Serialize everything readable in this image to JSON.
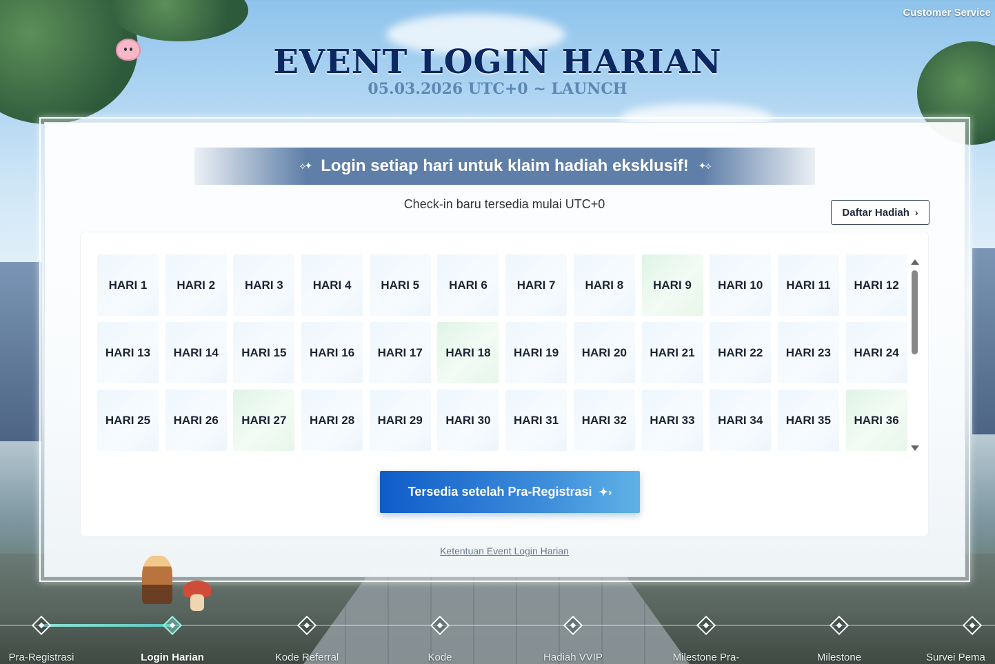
{
  "header": {
    "customer_service": "Customer Service",
    "title": "EVENT LOGIN HARIAN",
    "subtitle": "05.03.2026 UTC+0 ~ LAUNCH"
  },
  "panel": {
    "banner_text": "Login setiap hari untuk klaim hadiah eksklusif!",
    "checkin_note": "Check-in baru tersedia mulai UTC+0",
    "reward_list_button": "Daftar Hadiah",
    "cta_button": "Tersedia setelah Pra-Registrasi",
    "terms_link": "Ketentuan Event Login Harian"
  },
  "days": [
    {
      "label": "HARI 1",
      "highlight": false
    },
    {
      "label": "HARI 2",
      "highlight": false
    },
    {
      "label": "HARI 3",
      "highlight": false
    },
    {
      "label": "HARI 4",
      "highlight": false
    },
    {
      "label": "HARI 5",
      "highlight": false
    },
    {
      "label": "HARI 6",
      "highlight": false
    },
    {
      "label": "HARI 7",
      "highlight": false
    },
    {
      "label": "HARI 8",
      "highlight": false
    },
    {
      "label": "HARI 9",
      "highlight": true
    },
    {
      "label": "HARI 10",
      "highlight": false
    },
    {
      "label": "HARI 11",
      "highlight": false
    },
    {
      "label": "HARI 12",
      "highlight": false
    },
    {
      "label": "HARI 13",
      "highlight": false
    },
    {
      "label": "HARI 14",
      "highlight": false
    },
    {
      "label": "HARI 15",
      "highlight": false
    },
    {
      "label": "HARI 16",
      "highlight": false
    },
    {
      "label": "HARI 17",
      "highlight": false
    },
    {
      "label": "HARI 18",
      "highlight": true
    },
    {
      "label": "HARI 19",
      "highlight": false
    },
    {
      "label": "HARI 20",
      "highlight": false
    },
    {
      "label": "HARI 21",
      "highlight": false
    },
    {
      "label": "HARI 22",
      "highlight": false
    },
    {
      "label": "HARI 23",
      "highlight": false
    },
    {
      "label": "HARI 24",
      "highlight": false
    },
    {
      "label": "HARI 25",
      "highlight": false
    },
    {
      "label": "HARI 26",
      "highlight": false
    },
    {
      "label": "HARI 27",
      "highlight": true
    },
    {
      "label": "HARI 28",
      "highlight": false
    },
    {
      "label": "HARI 29",
      "highlight": false
    },
    {
      "label": "HARI 30",
      "highlight": false
    },
    {
      "label": "HARI 31",
      "highlight": false
    },
    {
      "label": "HARI 32",
      "highlight": false
    },
    {
      "label": "HARI 33",
      "highlight": false
    },
    {
      "label": "HARI 34",
      "highlight": false
    },
    {
      "label": "HARI 35",
      "highlight": false
    },
    {
      "label": "HARI 36",
      "highlight": true
    }
  ],
  "bottom_nav": {
    "items": [
      {
        "label": "Pra-Registrasi",
        "active": false
      },
      {
        "label": "Login Harian",
        "active": true
      },
      {
        "label": "Kode Referral",
        "active": false
      },
      {
        "label": "Kode",
        "active": false
      },
      {
        "label": "Hadiah VVIP",
        "active": false
      },
      {
        "label": "Milestone Pra-",
        "active": false
      },
      {
        "label": "Milestone",
        "active": false
      },
      {
        "label": "Survei Pema",
        "active": false
      }
    ]
  },
  "icons": {
    "reward_chevron": "chevron-right-icon",
    "cta_icon": "sparkle-arrow-icon",
    "nav_node": "diamond-node-icon"
  },
  "colors": {
    "title": "#0d2760",
    "subtitle": "#5d87b4",
    "cta_start": "#0f5cc9",
    "cta_end": "#5fb2e6",
    "day_highlight": "#dff4e6"
  }
}
